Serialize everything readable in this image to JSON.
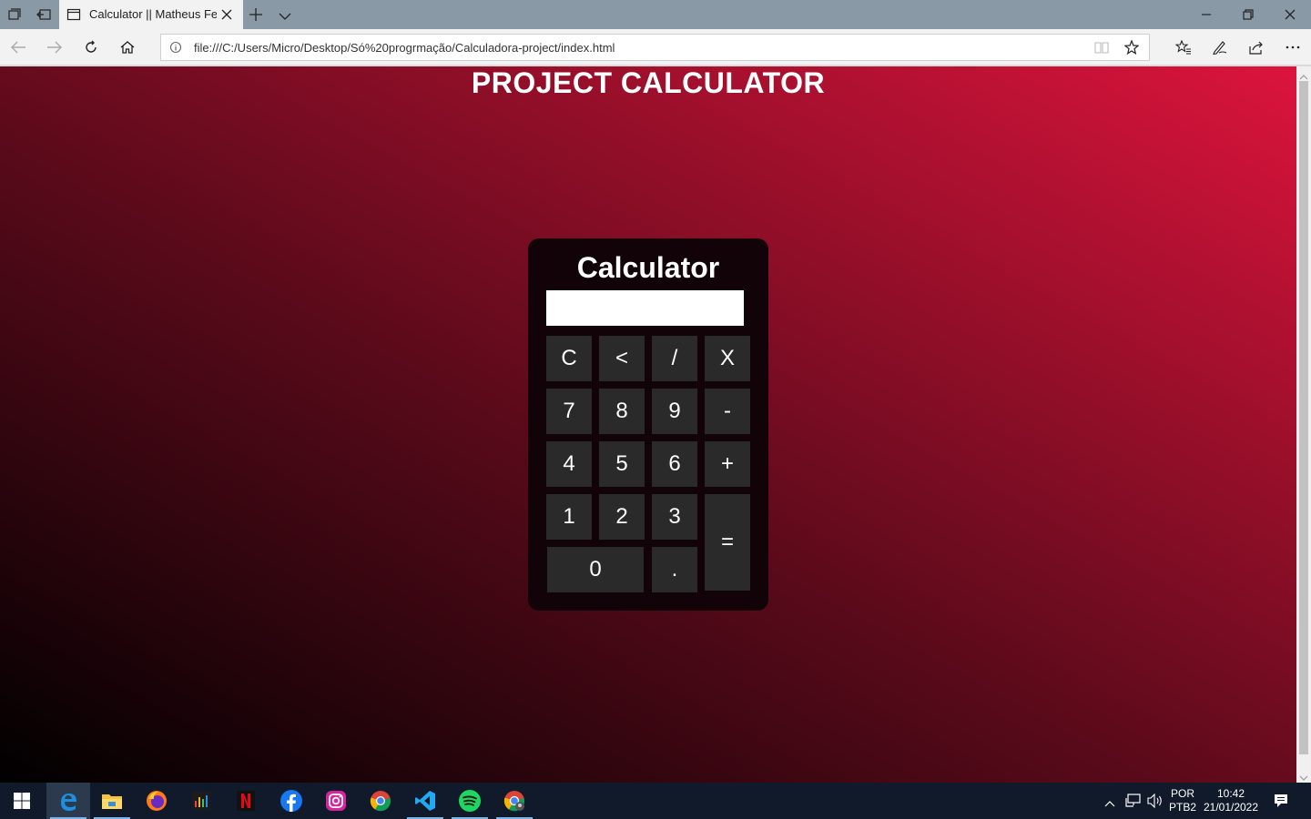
{
  "browser": {
    "tab_title": "Calculator || Matheus Fe",
    "address_url": "file:///C:/Users/Micro/Desktop/Só%20progrmação/Calculadora-project/index.html"
  },
  "page": {
    "heading": "PROJECT CALCULATOR",
    "calculator": {
      "title": "Calculator",
      "display_value": "",
      "keys": {
        "clear": "C",
        "backspace": "<",
        "divide": "/",
        "multiply": "X",
        "seven": "7",
        "eight": "8",
        "nine": "9",
        "minus": "-",
        "four": "4",
        "five": "5",
        "six": "6",
        "plus": "+",
        "one": "1",
        "two": "2",
        "three": "3",
        "equals": "=",
        "zero": "0",
        "decimal": "."
      }
    }
  },
  "taskbar": {
    "apps": [
      "edge-icon",
      "file-explorer-icon",
      "firefox-icon",
      "equalizer-app-icon",
      "netflix-icon",
      "facebook-icon",
      "instagram-icon",
      "chrome-icon",
      "vscode-icon",
      "spotify-icon",
      "chrome-canary-icon"
    ],
    "language": "POR",
    "keyboard": "PTB2",
    "time": "10:42",
    "date": "21/01/2022"
  },
  "colors": {
    "gradient_start": "#000000",
    "gradient_mid": "#5a0a1a",
    "gradient_end": "#dc143c",
    "calculator_bg": "#110308",
    "key_bg": "#2a2a2a"
  }
}
